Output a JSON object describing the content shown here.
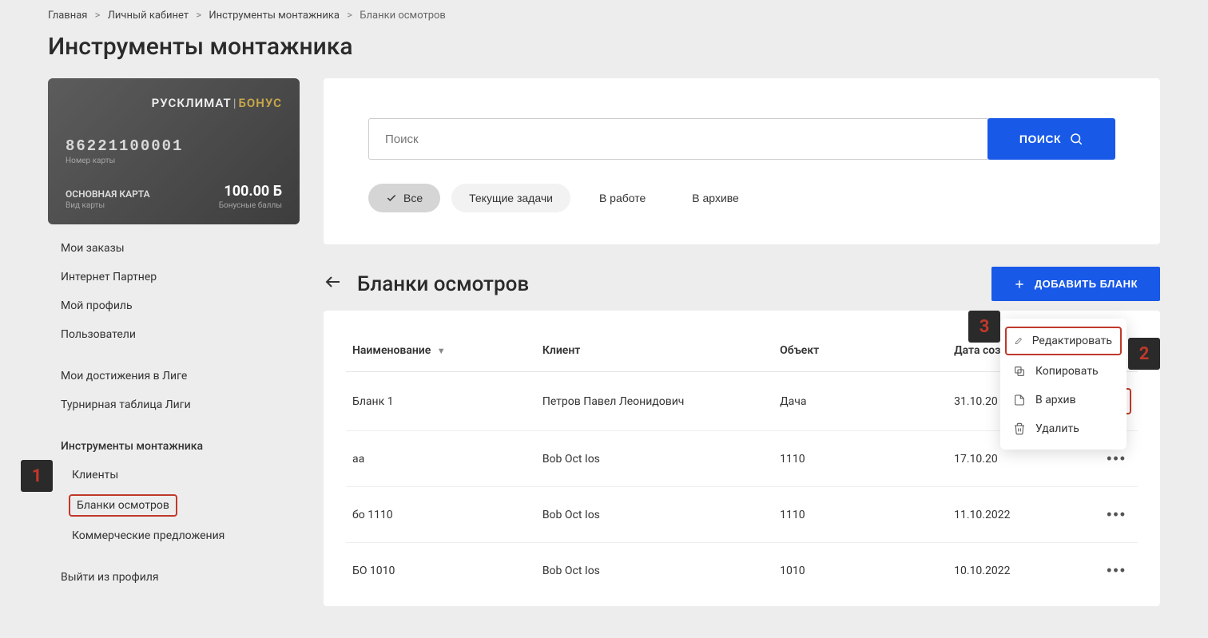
{
  "breadcrumb": {
    "items": [
      "Главная",
      "Личный кабинет",
      "Инструменты монтажника",
      "Бланки осмотров"
    ]
  },
  "page_title": "Инструменты монтажника",
  "card": {
    "brand1": "РУСКЛИМАТ",
    "brand2": "БОНУС",
    "number": "86221100001",
    "number_label": "Номер карты",
    "type": "ОСНОВНАЯ КАРТА",
    "type_label": "Вид карты",
    "balance": "100.00 Б",
    "balance_label": "Бонусные баллы"
  },
  "sidebar": {
    "items": [
      {
        "label": "Мои заказы"
      },
      {
        "label": "Интернет Партнер"
      },
      {
        "label": "Мой профиль"
      },
      {
        "label": "Пользователи"
      }
    ],
    "group2": [
      {
        "label": "Мои достижения в Лиге"
      },
      {
        "label": "Турнирная таблица Лиги"
      }
    ],
    "tools_heading": "Инструменты монтажника",
    "tools_sub": [
      {
        "label": "Клиенты"
      },
      {
        "label": "Бланки осмотров"
      },
      {
        "label": "Коммерческие предложения"
      }
    ],
    "logout": "Выйти из профиля"
  },
  "search": {
    "placeholder": "Поиск",
    "button": "ПОИСК"
  },
  "filters": {
    "all": "Все",
    "current": "Текущие задачи",
    "in_work": "В работе",
    "archived": "В архиве"
  },
  "section": {
    "title": "Бланки осмотров",
    "add_button": "ДОБАВИТЬ БЛАНК"
  },
  "table": {
    "headers": {
      "name": "Наименование",
      "client": "Клиент",
      "object": "Объект",
      "date": "Дата соз"
    },
    "rows": [
      {
        "name": "Бланк 1",
        "client": "Петров Павел Леонидович",
        "object": "Дача",
        "date": "31.10.20"
      },
      {
        "name": "aa",
        "client": "Bob Oct Ios",
        "object": "1110",
        "date": "17.10.20"
      },
      {
        "name": "бо 1110",
        "client": "Bob Oct Ios",
        "object": "1110",
        "date": "11.10.2022"
      },
      {
        "name": "БО 1010",
        "client": "Bob Oct Ios",
        "object": "1010",
        "date": "10.10.2022"
      }
    ]
  },
  "context_menu": {
    "edit": "Редактировать",
    "copy": "Копировать",
    "archive": "В архив",
    "delete": "Удалить"
  },
  "annotations": {
    "a1": "1",
    "a2": "2",
    "a3": "3"
  }
}
